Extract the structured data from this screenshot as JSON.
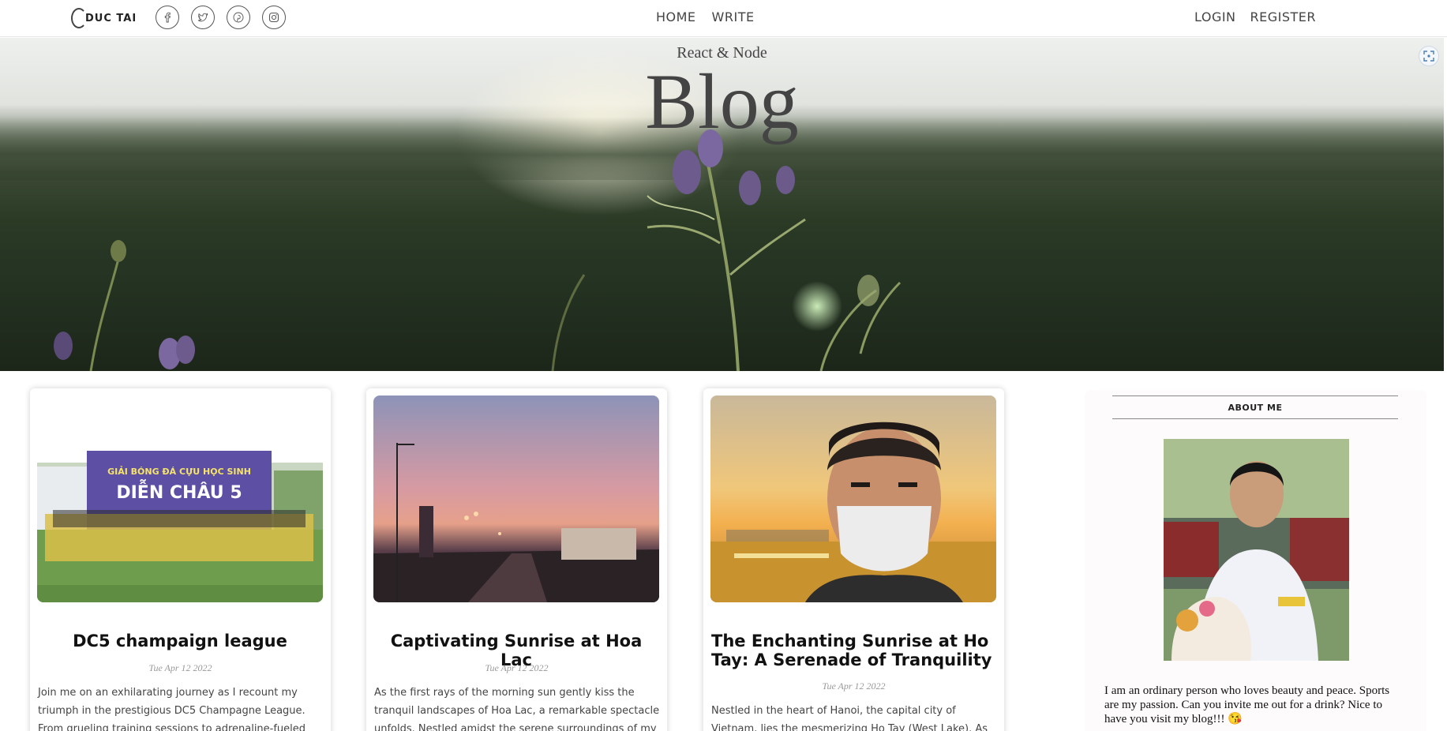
{
  "topbar": {
    "brand": "DUC TAI",
    "social_icons": [
      "facebook-icon",
      "twitter-icon",
      "pinterest-icon",
      "instagram-icon"
    ],
    "nav_center": [
      "HOME",
      "WRITE"
    ],
    "nav_right": [
      "LOGIN",
      "REGISTER"
    ]
  },
  "header": {
    "subtitle": "React & Node",
    "title": "Blog"
  },
  "posts": [
    {
      "title": "DC5 champaign league",
      "date": "Tue Apr 12 2022",
      "description": "Join me on an exhilarating journey as I recount my triumph in the prestigious DC5 Champagne League. From grueling training sessions to adrenaline-fueled matches",
      "banner_text": "GIẢI BÓNG ĐÁ CỰU HỌC SINH",
      "banner_big": "DIỄN CHÂU 5"
    },
    {
      "title": "Captivating Sunrise at Hoa Lac",
      "date": "Tue Apr 12 2022",
      "description": "As the first rays of the morning sun gently kiss the tranquil landscapes of Hoa Lac, a remarkable spectacle unfolds. Nestled amidst the serene surroundings of my"
    },
    {
      "title": "The Enchanting Sunrise at Ho Tay: A Serenade of Tranquility",
      "date": "Tue Apr 12 2022",
      "description": "Nestled in the heart of Hanoi, the capital city of Vietnam, lies the mesmerizing Ho Tay (West Lake). As the dawn"
    }
  ],
  "sidebar": {
    "title": "ABOUT ME",
    "text": "I am an ordinary person who loves beauty and peace. Sports are my passion. Can you invite me out for a drink? Nice to have you visit my blog!!! 😘"
  }
}
